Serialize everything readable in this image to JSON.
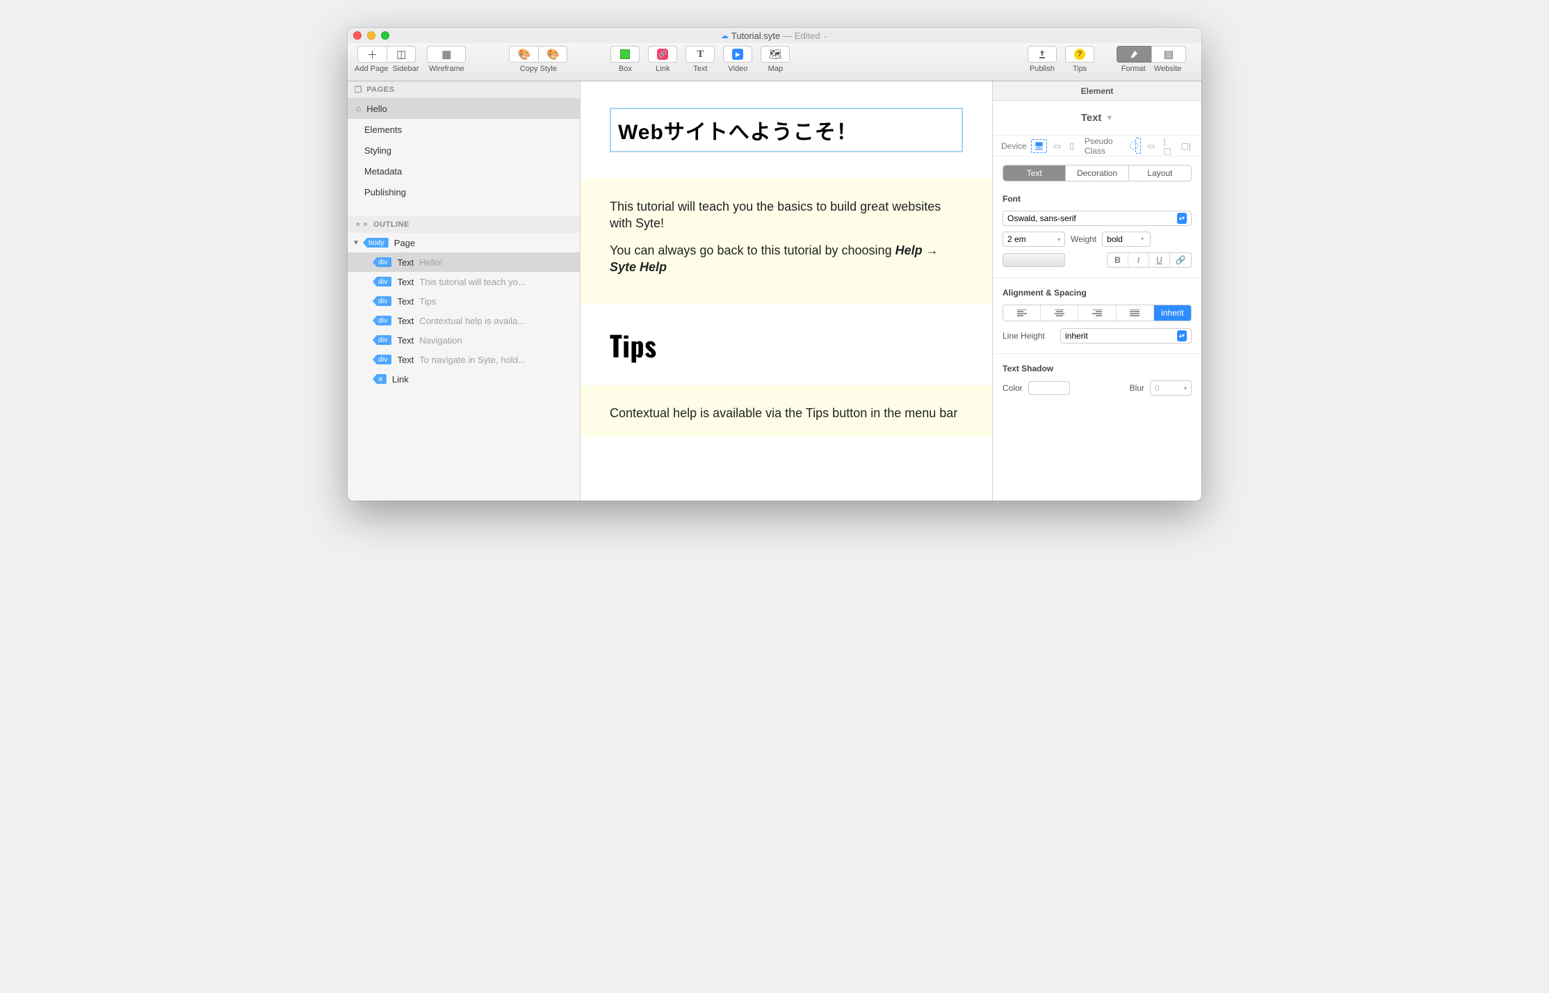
{
  "window": {
    "filename": "Tutorial.syte",
    "status": "Edited"
  },
  "toolbar": {
    "add_page": "Add Page",
    "sidebar": "Sidebar",
    "wireframe": "Wireframe",
    "copy_style": "Copy Style",
    "box": "Box",
    "link": "Link",
    "text": "Text",
    "video": "Video",
    "map": "Map",
    "publish": "Publish",
    "tips": "Tips",
    "format": "Format",
    "website": "Website"
  },
  "sidebar": {
    "pages_header": "PAGES",
    "outline_header": "OUTLINE",
    "pages": [
      {
        "icon": "home",
        "label": "Hello",
        "selected": true
      },
      {
        "label": "Elements"
      },
      {
        "label": "Styling"
      },
      {
        "label": "Metadata"
      },
      {
        "label": "Publishing"
      }
    ],
    "outline": [
      {
        "tag": "body",
        "role": "Page",
        "indent": 0,
        "arrow": "▼"
      },
      {
        "tag": "div",
        "role": "Text",
        "preview": "Hello!",
        "indent": 1,
        "selected": true
      },
      {
        "tag": "div",
        "role": "Text",
        "preview": "This tutorial will teach yo...",
        "indent": 1
      },
      {
        "tag": "div",
        "role": "Text",
        "preview": "Tips",
        "indent": 1
      },
      {
        "tag": "div",
        "role": "Text",
        "preview": "Contextual help is availa...",
        "indent": 1
      },
      {
        "tag": "div",
        "role": "Text",
        "preview": "Navigation",
        "indent": 1
      },
      {
        "tag": "div",
        "role": "Text",
        "preview": "To navigate in Syte, hold...",
        "indent": 1
      },
      {
        "tag": "a",
        "role": "Link",
        "indent": 1
      }
    ]
  },
  "canvas": {
    "heading_jp": "Webサイトへようこそ！",
    "intro_p1": "This tutorial will teach you the basics to build great websites with Syte!",
    "intro_p2_a": "You can always go back to this tutorial by choosing ",
    "intro_p2_b": "Help → Syte Help",
    "tips_heading": "Tips",
    "tips_p1": "Contextual help is available via the Tips button in the menu bar"
  },
  "inspector": {
    "element_header": "Element",
    "type_label": "Text",
    "device_label": "Device",
    "pseudo_label": "Pseudo Class",
    "tabs": {
      "text": "Text",
      "decoration": "Decoration",
      "layout": "Layout"
    },
    "font_section": "Font",
    "font_family": "Oswald, sans-serif",
    "font_size": "2 em",
    "weight_label": "Weight",
    "weight_value": "bold",
    "b": "B",
    "i": "I",
    "u": "U",
    "align_section": "Alignment & Spacing",
    "align_inherit": "inherit",
    "line_height_label": "Line Height",
    "line_height_value": "inherit",
    "shadow_section": "Text Shadow",
    "color_label": "Color",
    "blur_label": "Blur",
    "blur_value": "0"
  }
}
